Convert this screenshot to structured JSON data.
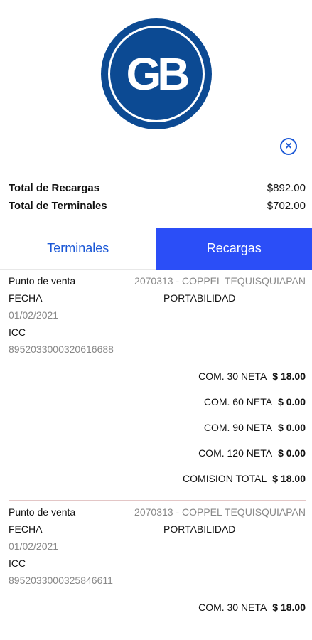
{
  "logo": {
    "text": "GB"
  },
  "totals": {
    "recargas_label": "Total de Recargas",
    "recargas_value": "$892.00",
    "terminales_label": "Total de Terminales",
    "terminales_value": "$702.00"
  },
  "tabs": [
    {
      "label": "Terminales"
    },
    {
      "label": "Recargas"
    }
  ],
  "records": [
    {
      "punto_label": "Punto de venta",
      "punto_value": "2070313 - COPPEL TEQUISQUIAPAN",
      "fecha_label": "FECHA",
      "tipo": "PORTABILIDAD",
      "fecha_value": "01/02/2021",
      "icc_label": "ICC",
      "icc_value": "8952033000320616688",
      "commissions": [
        {
          "label": "COM. 30 NETA",
          "value": "$ 18.00"
        },
        {
          "label": "COM. 60 NETA",
          "value": "$ 0.00"
        },
        {
          "label": "COM. 90 NETA",
          "value": "$ 0.00"
        },
        {
          "label": "COM. 120 NETA",
          "value": "$ 0.00"
        },
        {
          "label": "COMISION TOTAL",
          "value": "$ 18.00"
        }
      ]
    },
    {
      "punto_label": "Punto de venta",
      "punto_value": "2070313 - COPPEL TEQUISQUIAPAN",
      "fecha_label": "FECHA",
      "tipo": "PORTABILIDAD",
      "fecha_value": "01/02/2021",
      "icc_label": "ICC",
      "icc_value": "8952033000325846611",
      "commissions": [
        {
          "label": "COM. 30 NETA",
          "value": "$ 18.00"
        }
      ]
    }
  ]
}
